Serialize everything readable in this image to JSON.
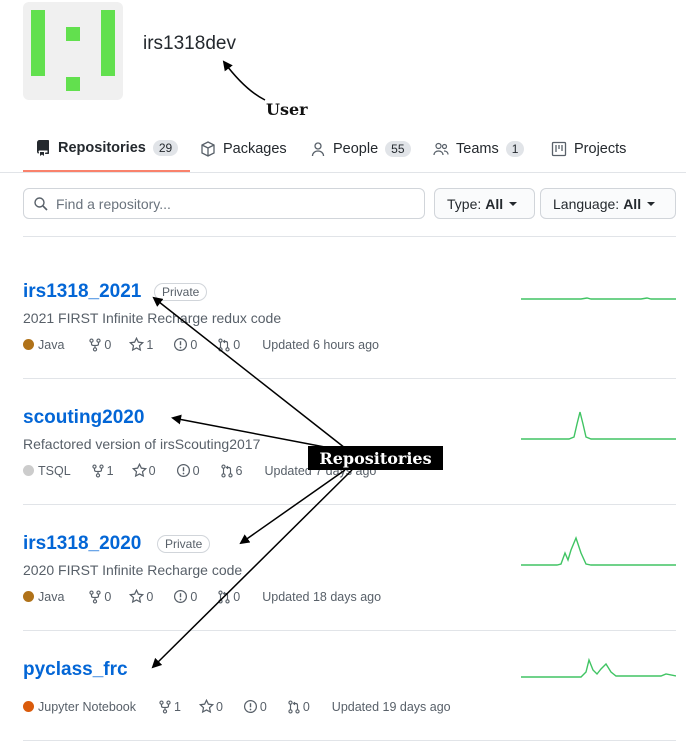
{
  "org": {
    "name": "irs1318dev"
  },
  "annotations": {
    "user": "User",
    "repositories": "Repositories"
  },
  "tabs": [
    {
      "label": "Repositories",
      "count": "29",
      "icon": "repo-icon"
    },
    {
      "label": "Packages",
      "icon": "package-icon"
    },
    {
      "label": "People",
      "count": "55",
      "icon": "person-icon"
    },
    {
      "label": "Teams",
      "count": "1",
      "icon": "people-icon"
    },
    {
      "label": "Projects",
      "icon": "project-icon"
    }
  ],
  "search": {
    "placeholder": "Find a repository..."
  },
  "filters": {
    "type_label": "Type:",
    "type_value": "All",
    "language_label": "Language:",
    "language_value": "All"
  },
  "colors": {
    "accent_tab": "#f9826c",
    "link": "#0366d6",
    "java": "#b07219",
    "tsql": "#cccccc",
    "jupyter": "#DA5B0B",
    "sparkline": "#40c463"
  },
  "repos": [
    {
      "name": "irs1318_2021",
      "badge": "Private",
      "description": "2021 FIRST Infinite Recharge redux code",
      "language": "Java",
      "forks": "0",
      "stars": "1",
      "issues": "0",
      "prs": "0",
      "updated": "Updated 6 hours ago"
    },
    {
      "name": "scouting2020",
      "badge": "",
      "description": "Refactored version of irsScouting2017",
      "language": "TSQL",
      "forks": "1",
      "stars": "0",
      "issues": "0",
      "prs": "6",
      "updated": "Updated 7 days ago"
    },
    {
      "name": "irs1318_2020",
      "badge": "Private",
      "description": "2020 FIRST Infinite Recharge code",
      "language": "Java",
      "forks": "0",
      "stars": "0",
      "issues": "0",
      "prs": "0",
      "updated": "Updated 18 days ago"
    },
    {
      "name": "pyclass_frc",
      "badge": "",
      "description": "",
      "language": "Jupyter Notebook",
      "forks": "1",
      "stars": "0",
      "issues": "0",
      "prs": "0",
      "updated": "Updated 19 days ago"
    }
  ]
}
